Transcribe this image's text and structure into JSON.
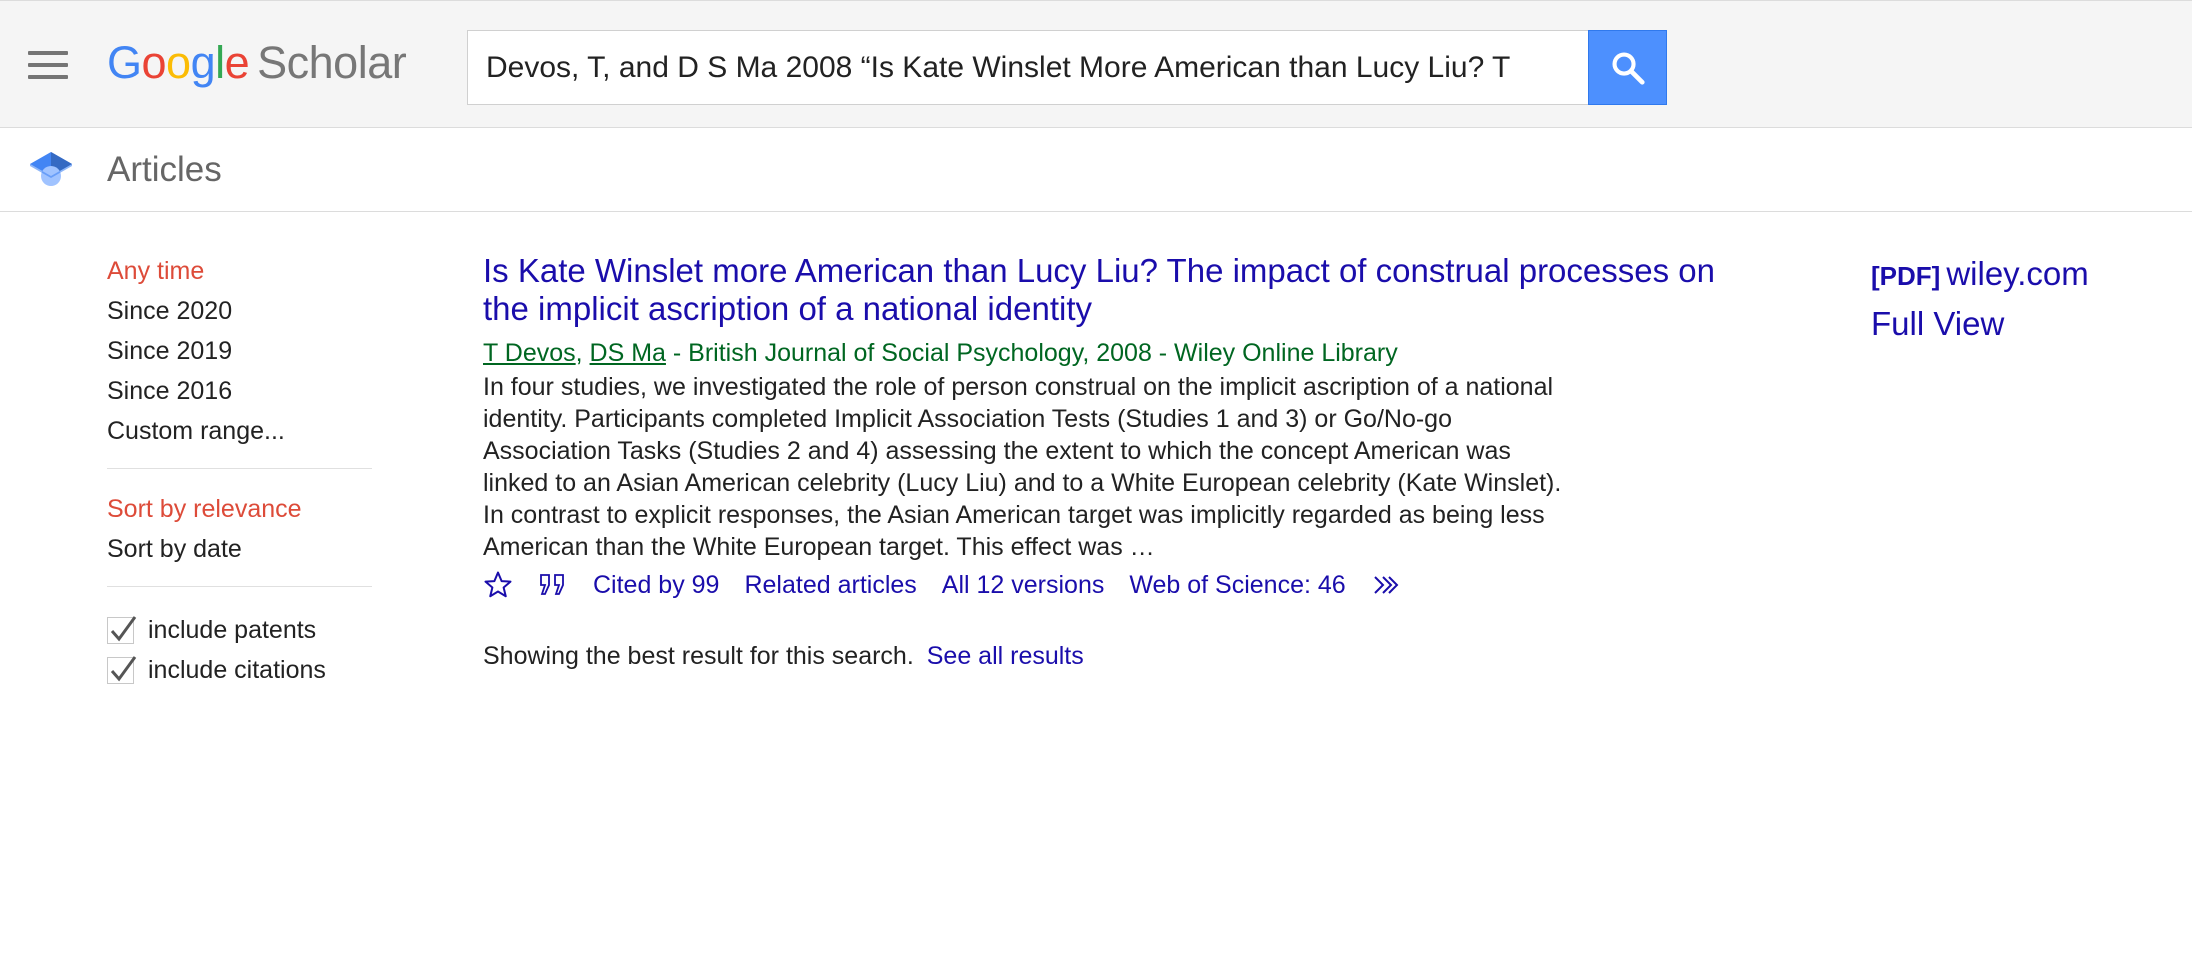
{
  "header": {
    "logo_google": [
      "G",
      "o",
      "o",
      "g",
      "l",
      "e"
    ],
    "logo_scholar": "Scholar",
    "search_value": "Devos, T, and D S Ma 2008 “Is Kate Winslet More American than Lucy Liu? T"
  },
  "subheader": {
    "title": "Articles"
  },
  "sidebar": {
    "time_filters": [
      "Any time",
      "Since 2020",
      "Since 2019",
      "Since 2016",
      "Custom range..."
    ],
    "sort_options": [
      "Sort by relevance",
      "Sort by date"
    ],
    "checkboxes": [
      {
        "label": "include patents",
        "checked": true
      },
      {
        "label": "include citations",
        "checked": true
      }
    ]
  },
  "result": {
    "title": "Is Kate Winslet more American than Lucy Liu? The impact of construal processes on the implicit ascription of a national identity",
    "authors": [
      "T Devos",
      "DS Ma"
    ],
    "source": " - British Journal of Social Psychology, 2008 - Wiley Online Library",
    "snippet": "In four studies, we investigated the role of person construal on the implicit ascription of a national identity. Participants completed Implicit Association Tests (Studies 1 and 3) or Go/No-go Association Tasks (Studies 2 and 4) assessing the extent to which the concept American was linked to an Asian American celebrity (Lucy Liu) and to a White European celebrity (Kate Winslet). In contrast to explicit responses, the Asian American target was implicitly regarded as being less American than the White European target. This effect was …",
    "actions": {
      "cited_by": "Cited by 99",
      "related": "Related articles",
      "versions": "All 12 versions",
      "wos": "Web of Science: 46"
    }
  },
  "footer_note": {
    "text": "Showing the best result for this search.",
    "link": "See all results"
  },
  "side_links": {
    "pdf_tag": "[PDF]",
    "pdf_domain": "wiley.com",
    "full_view": "Full View"
  },
  "colors": {
    "link": "#1a0dab",
    "green": "#006621",
    "active_red": "#dd4b39",
    "search_blue": "#4d90fe"
  }
}
